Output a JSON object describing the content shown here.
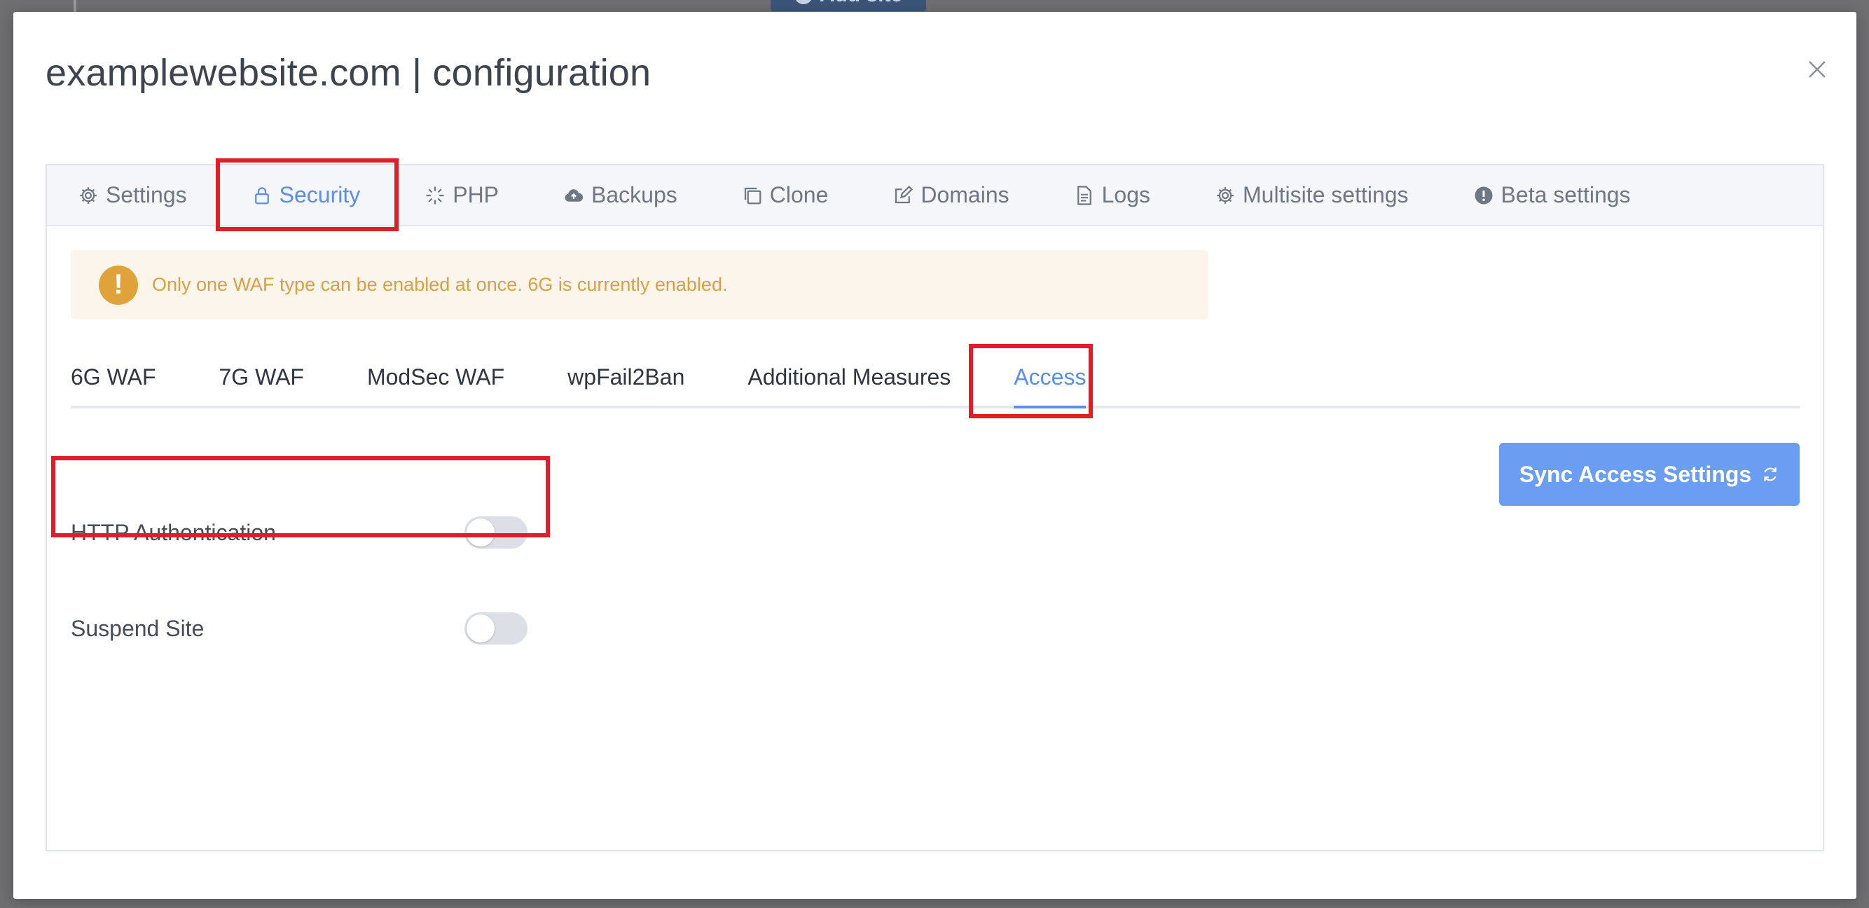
{
  "background": {
    "add_site_label": "Add site"
  },
  "modal": {
    "title": "examplewebsite.com | configuration"
  },
  "main_tabs": [
    {
      "label": "Settings",
      "icon": "gear-icon"
    },
    {
      "label": "Security",
      "icon": "lock-icon",
      "active": true
    },
    {
      "label": "PHP",
      "icon": "loader-icon"
    },
    {
      "label": "Backups",
      "icon": "cloud-upload-icon"
    },
    {
      "label": "Clone",
      "icon": "copy-icon"
    },
    {
      "label": "Domains",
      "icon": "edit-icon"
    },
    {
      "label": "Logs",
      "icon": "document-icon"
    },
    {
      "label": "Multisite settings",
      "icon": "gear-icon"
    },
    {
      "label": "Beta settings",
      "icon": "exclamation-circle-icon"
    }
  ],
  "alert": {
    "text": "Only one WAF type can be enabled at once. 6G is currently enabled."
  },
  "sub_tabs": [
    {
      "label": "6G WAF"
    },
    {
      "label": "7G WAF"
    },
    {
      "label": "ModSec WAF"
    },
    {
      "label": "wpFail2Ban"
    },
    {
      "label": "Additional Measures"
    },
    {
      "label": "Access",
      "active": true
    }
  ],
  "sync_button": {
    "label": "Sync Access Settings",
    "icon": "refresh-icon"
  },
  "settings": [
    {
      "label": "HTTP Authentication",
      "enabled": false
    },
    {
      "label": "Suspend Site",
      "enabled": false
    }
  ],
  "colors": {
    "accent": "#5a8eea",
    "highlight": "#e01e27",
    "warning": "#e0a33c"
  }
}
